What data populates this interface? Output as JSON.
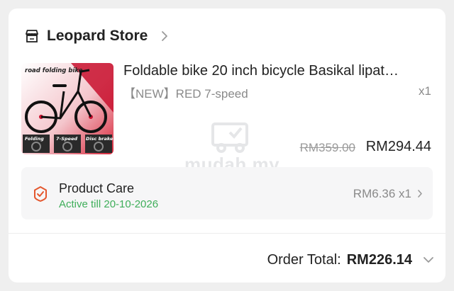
{
  "store": {
    "name": "Leopard Store",
    "icon": "store-icon"
  },
  "product": {
    "title": "Foldable bike 20 inch bicycle Basikal lipat…",
    "variant": "【NEW】RED 7-speed",
    "quantity": "x1",
    "original_price": "RM359.00",
    "price": "RM294.44",
    "thumbnail": {
      "caption": "road folding bike",
      "badges": [
        "Folding",
        "7-Speed",
        "Disc brake"
      ]
    }
  },
  "watermark": "mudah.my",
  "product_care": {
    "title": "Product Care",
    "status": "Active till 20-10-2026",
    "price_qty": "RM6.36 x1",
    "icon": "shield-check-icon"
  },
  "order_total": {
    "label": "Order Total:",
    "value": "RM226.14"
  },
  "colors": {
    "accent_green": "#3fae5a",
    "care_icon": "#e4572e",
    "text_muted": "#8a8a8a"
  }
}
